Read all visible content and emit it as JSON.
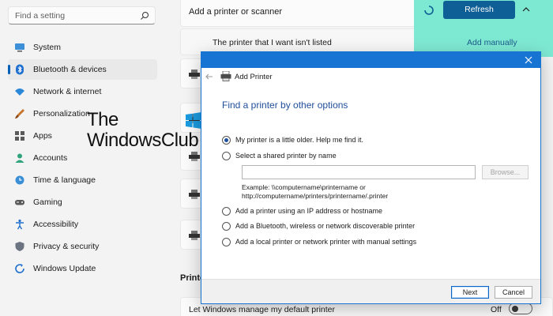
{
  "nav": {
    "search_placeholder": "Find a setting",
    "items": [
      {
        "label": "System",
        "icon": "monitor-icon"
      },
      {
        "label": "Bluetooth & devices",
        "icon": "bluetooth-icon"
      },
      {
        "label": "Network & internet",
        "icon": "wifi-icon"
      },
      {
        "label": "Personalization",
        "icon": "brush-icon"
      },
      {
        "label": "Apps",
        "icon": "apps-grid-icon"
      },
      {
        "label": "Accounts",
        "icon": "person-icon"
      },
      {
        "label": "Time & language",
        "icon": "globe-clock-icon"
      },
      {
        "label": "Gaming",
        "icon": "gamepad-icon"
      },
      {
        "label": "Accessibility",
        "icon": "accessibility-icon"
      },
      {
        "label": "Privacy & security",
        "icon": "shield-icon"
      },
      {
        "label": "Windows Update",
        "icon": "update-icon"
      }
    ],
    "selected_index": 1
  },
  "watermark": {
    "line1": "The",
    "line2": "WindowsClub"
  },
  "settings": {
    "add_printer_label": "Add a printer or scanner",
    "refresh_label": "Refresh",
    "missing_label": "The printer that I want isn't listed",
    "add_manually_label": "Add manually",
    "section_partial": "Printe",
    "default_printer_label": "Let Windows manage my default printer",
    "default_printer_state": "Off",
    "accent_color": "#0e5f96",
    "highlight_color": "#7ee9d3"
  },
  "dialog": {
    "title": "Add Printer",
    "heading": "Find a printer by other options",
    "options": [
      {
        "label": "My printer is a little older. Help me find it.",
        "selected": true
      },
      {
        "label": "Select a shared printer by name",
        "selected": false
      },
      {
        "label": "Add a printer using an IP address or hostname",
        "selected": false
      },
      {
        "label": "Add a Bluetooth, wireless or network discoverable printer",
        "selected": false
      },
      {
        "label": "Add a local printer or network printer with manual settings",
        "selected": false
      }
    ],
    "shared_printer_value": "",
    "browse_label": "Browse...",
    "example_line1": "Example: \\\\computername\\printername or",
    "example_line2": "http://computername/printers/printername/.printer",
    "next_label": "Next",
    "cancel_label": "Cancel",
    "titlebar_color": "#1874d3"
  }
}
